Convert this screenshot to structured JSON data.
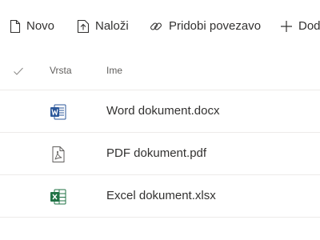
{
  "toolbar": {
    "new_label": "Novo",
    "upload_label": "Naloži",
    "link_label": "Pridobi povezavo",
    "add_label": "Dodaj"
  },
  "header": {
    "type_label": "Vrsta",
    "name_label": "Ime"
  },
  "files": [
    {
      "name": "Word dokument.docx",
      "icon": "word-icon",
      "color": "#2b579a"
    },
    {
      "name": "PDF dokument.pdf",
      "icon": "pdf-icon",
      "color": "#605e5c"
    },
    {
      "name": "Excel dokument.xlsx",
      "icon": "excel-icon",
      "color": "#217346"
    }
  ],
  "colors": {
    "text": "#323130",
    "header_text": "#605e5c",
    "divider": "#edebe9",
    "word": "#2b579a",
    "excel": "#217346"
  }
}
